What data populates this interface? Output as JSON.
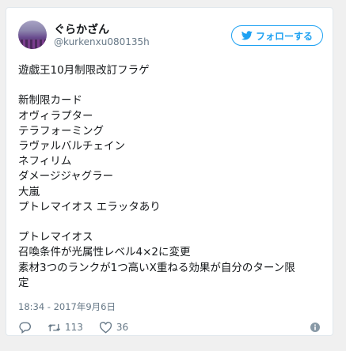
{
  "user": {
    "name": "ぐらかざん",
    "handle": "@kurkenxu080135h"
  },
  "follow_button": {
    "label": "フォローする",
    "icon": "twitter-bird-icon"
  },
  "tweet": {
    "text": "遊戯王10月制限改訂フラゲ\n\n新制限カード\nオヴィラプター\nテラフォーミング\nラヴァルバルチェイン\nネフィリム\nダメージジャグラー\n大嵐\nプトレマイオス エラッタあり\n\nプトレマイオス\n召喚条件が光属性レベル4×2に変更\n素材3つのランクが1つ高いX重ねる効果が自分のターン限\n定",
    "timestamp": "18:34 - 2017年9月6日"
  },
  "actions": {
    "reply": {
      "icon": "reply-icon"
    },
    "retweet": {
      "icon": "retweet-icon",
      "count": "113"
    },
    "like": {
      "icon": "heart-icon",
      "count": "36"
    },
    "info": {
      "icon": "info-icon"
    }
  },
  "colors": {
    "accent": "#1da1f2",
    "text": "#14171a",
    "muted": "#657786",
    "border": "#e1e8ed"
  }
}
